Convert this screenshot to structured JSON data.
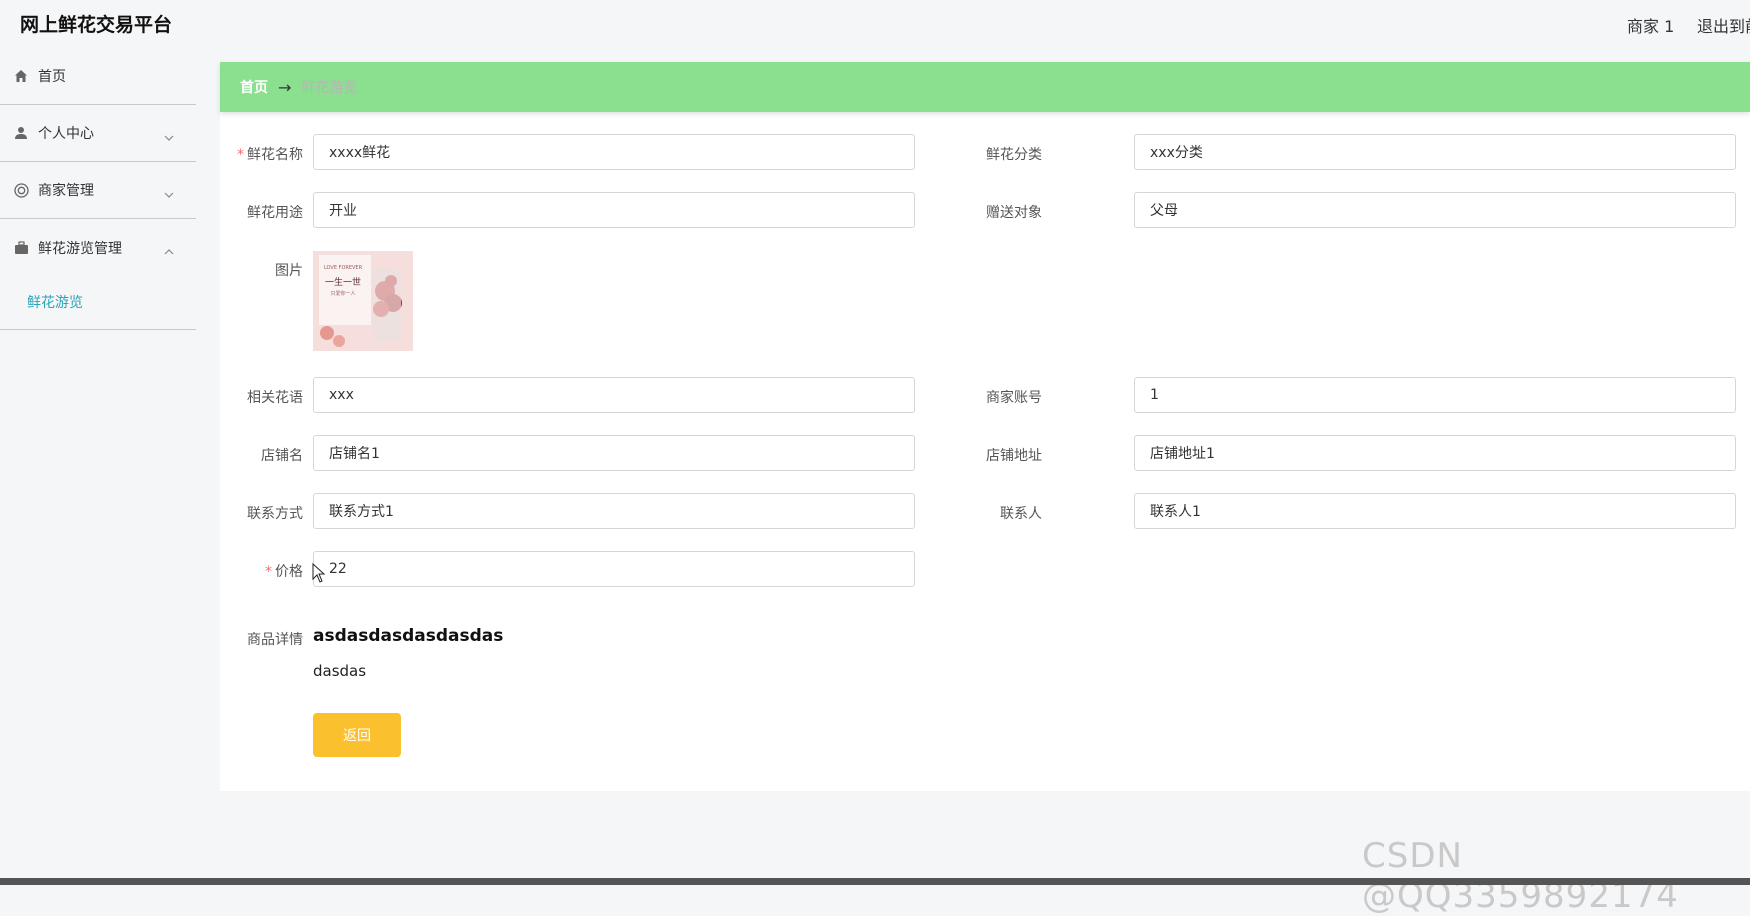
{
  "header": {
    "app_title": "网上鲜花交易平台",
    "user_name": "商家 1",
    "logout_label": "退出到前台"
  },
  "sidebar": {
    "items": [
      {
        "label": "首页",
        "icon": "home-icon"
      },
      {
        "label": "个人中心",
        "icon": "user-icon"
      },
      {
        "label": "商家管理",
        "icon": "store-icon"
      },
      {
        "label": "鲜花游览管理",
        "icon": "briefcase-icon"
      }
    ],
    "submenu": {
      "label": "鲜花游览"
    }
  },
  "breadcrumb": {
    "home": "首页",
    "separator": "→",
    "current": "鲜花游览"
  },
  "form": {
    "flower_name": {
      "label": "鲜花名称",
      "value": "xxxx鲜花",
      "required": true
    },
    "flower_category": {
      "label": "鲜花分类",
      "value": "xxx分类"
    },
    "flower_use": {
      "label": "鲜花用途",
      "value": "开业"
    },
    "gift_target": {
      "label": "赠送对象",
      "value": "父母"
    },
    "image": {
      "label": "图片",
      "image_text_top": "LOVE FOREVER",
      "image_text_main": "一生一世",
      "image_text_sub": "只爱你一人"
    },
    "flower_language": {
      "label": "相关花语",
      "value": "xxx"
    },
    "merchant_account": {
      "label": "商家账号",
      "value": "1"
    },
    "shop_name": {
      "label": "店铺名",
      "value": "店铺名1"
    },
    "shop_address": {
      "label": "店铺地址",
      "value": "店铺地址1"
    },
    "contact": {
      "label": "联系方式",
      "value": "联系方式1"
    },
    "contact_person": {
      "label": "联系人",
      "value": "联系人1"
    },
    "price": {
      "label": "价格",
      "value": "22",
      "required": true
    },
    "details": {
      "label": "商品详情",
      "heading": "asdasdasdasdasdas",
      "body": "dasdas"
    }
  },
  "actions": {
    "back_label": "返回"
  },
  "watermark": "CSDN @QQ3359892174",
  "colors": {
    "breadcrumb_bg": "#8ae08e",
    "accent_link": "#2aa3b8",
    "back_button": "#fbc02d",
    "required": "#f56c6c"
  }
}
